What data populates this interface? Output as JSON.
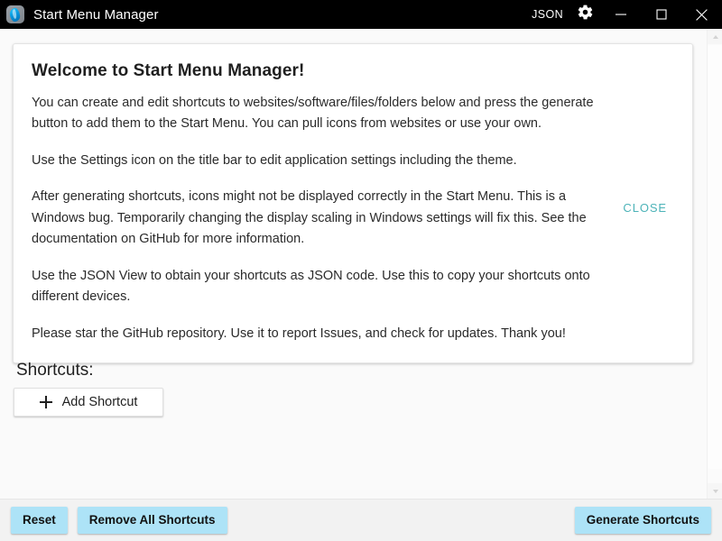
{
  "window": {
    "title": "Start Menu Manager",
    "app_icon": "app-logo-icon",
    "titlebar_bg": "#000000",
    "titlebar_fg": "#ffffff"
  },
  "titlebar_actions": {
    "json_label": "JSON",
    "settings_icon": "gear-icon",
    "minimize_icon": "minimize-icon",
    "maximize_icon": "maximize-icon",
    "close_icon": "close-icon"
  },
  "welcome_card": {
    "title": "Welcome to Start Menu Manager!",
    "paragraphs": [
      "You can create and edit shortcuts to websites/software/files/folders below and press the generate button to add them to the Start Menu. You can pull icons from websites or use your own.",
      "Use the Settings icon on the title bar to edit application settings including the theme.",
      "After generating shortcuts, icons might not be displayed correctly in the Start Menu. This is a Windows bug. Temporarily changing the display scaling in Windows settings will fix this. See the documentation on GitHub for more information.",
      "Use the JSON View to obtain your shortcuts as JSON code. Use this to copy your shortcuts onto different devices.",
      "Please star the GitHub repository. Use it to report Issues, and check for updates. Thank you!"
    ],
    "close_label": "CLOSE",
    "close_color": "#4cb3b8"
  },
  "shortcuts_section": {
    "heading": "Shortcuts:",
    "add_button_label": "Add Shortcut",
    "add_button_icon": "plus-icon",
    "items": []
  },
  "bottom_bar": {
    "reset_label": "Reset",
    "remove_all_label": "Remove All Shortcuts",
    "generate_label": "Generate Shortcuts",
    "button_color": "#ade3f7"
  },
  "scrollbar": {
    "up_icon": "chevron-up-icon",
    "down_icon": "chevron-down-icon"
  }
}
